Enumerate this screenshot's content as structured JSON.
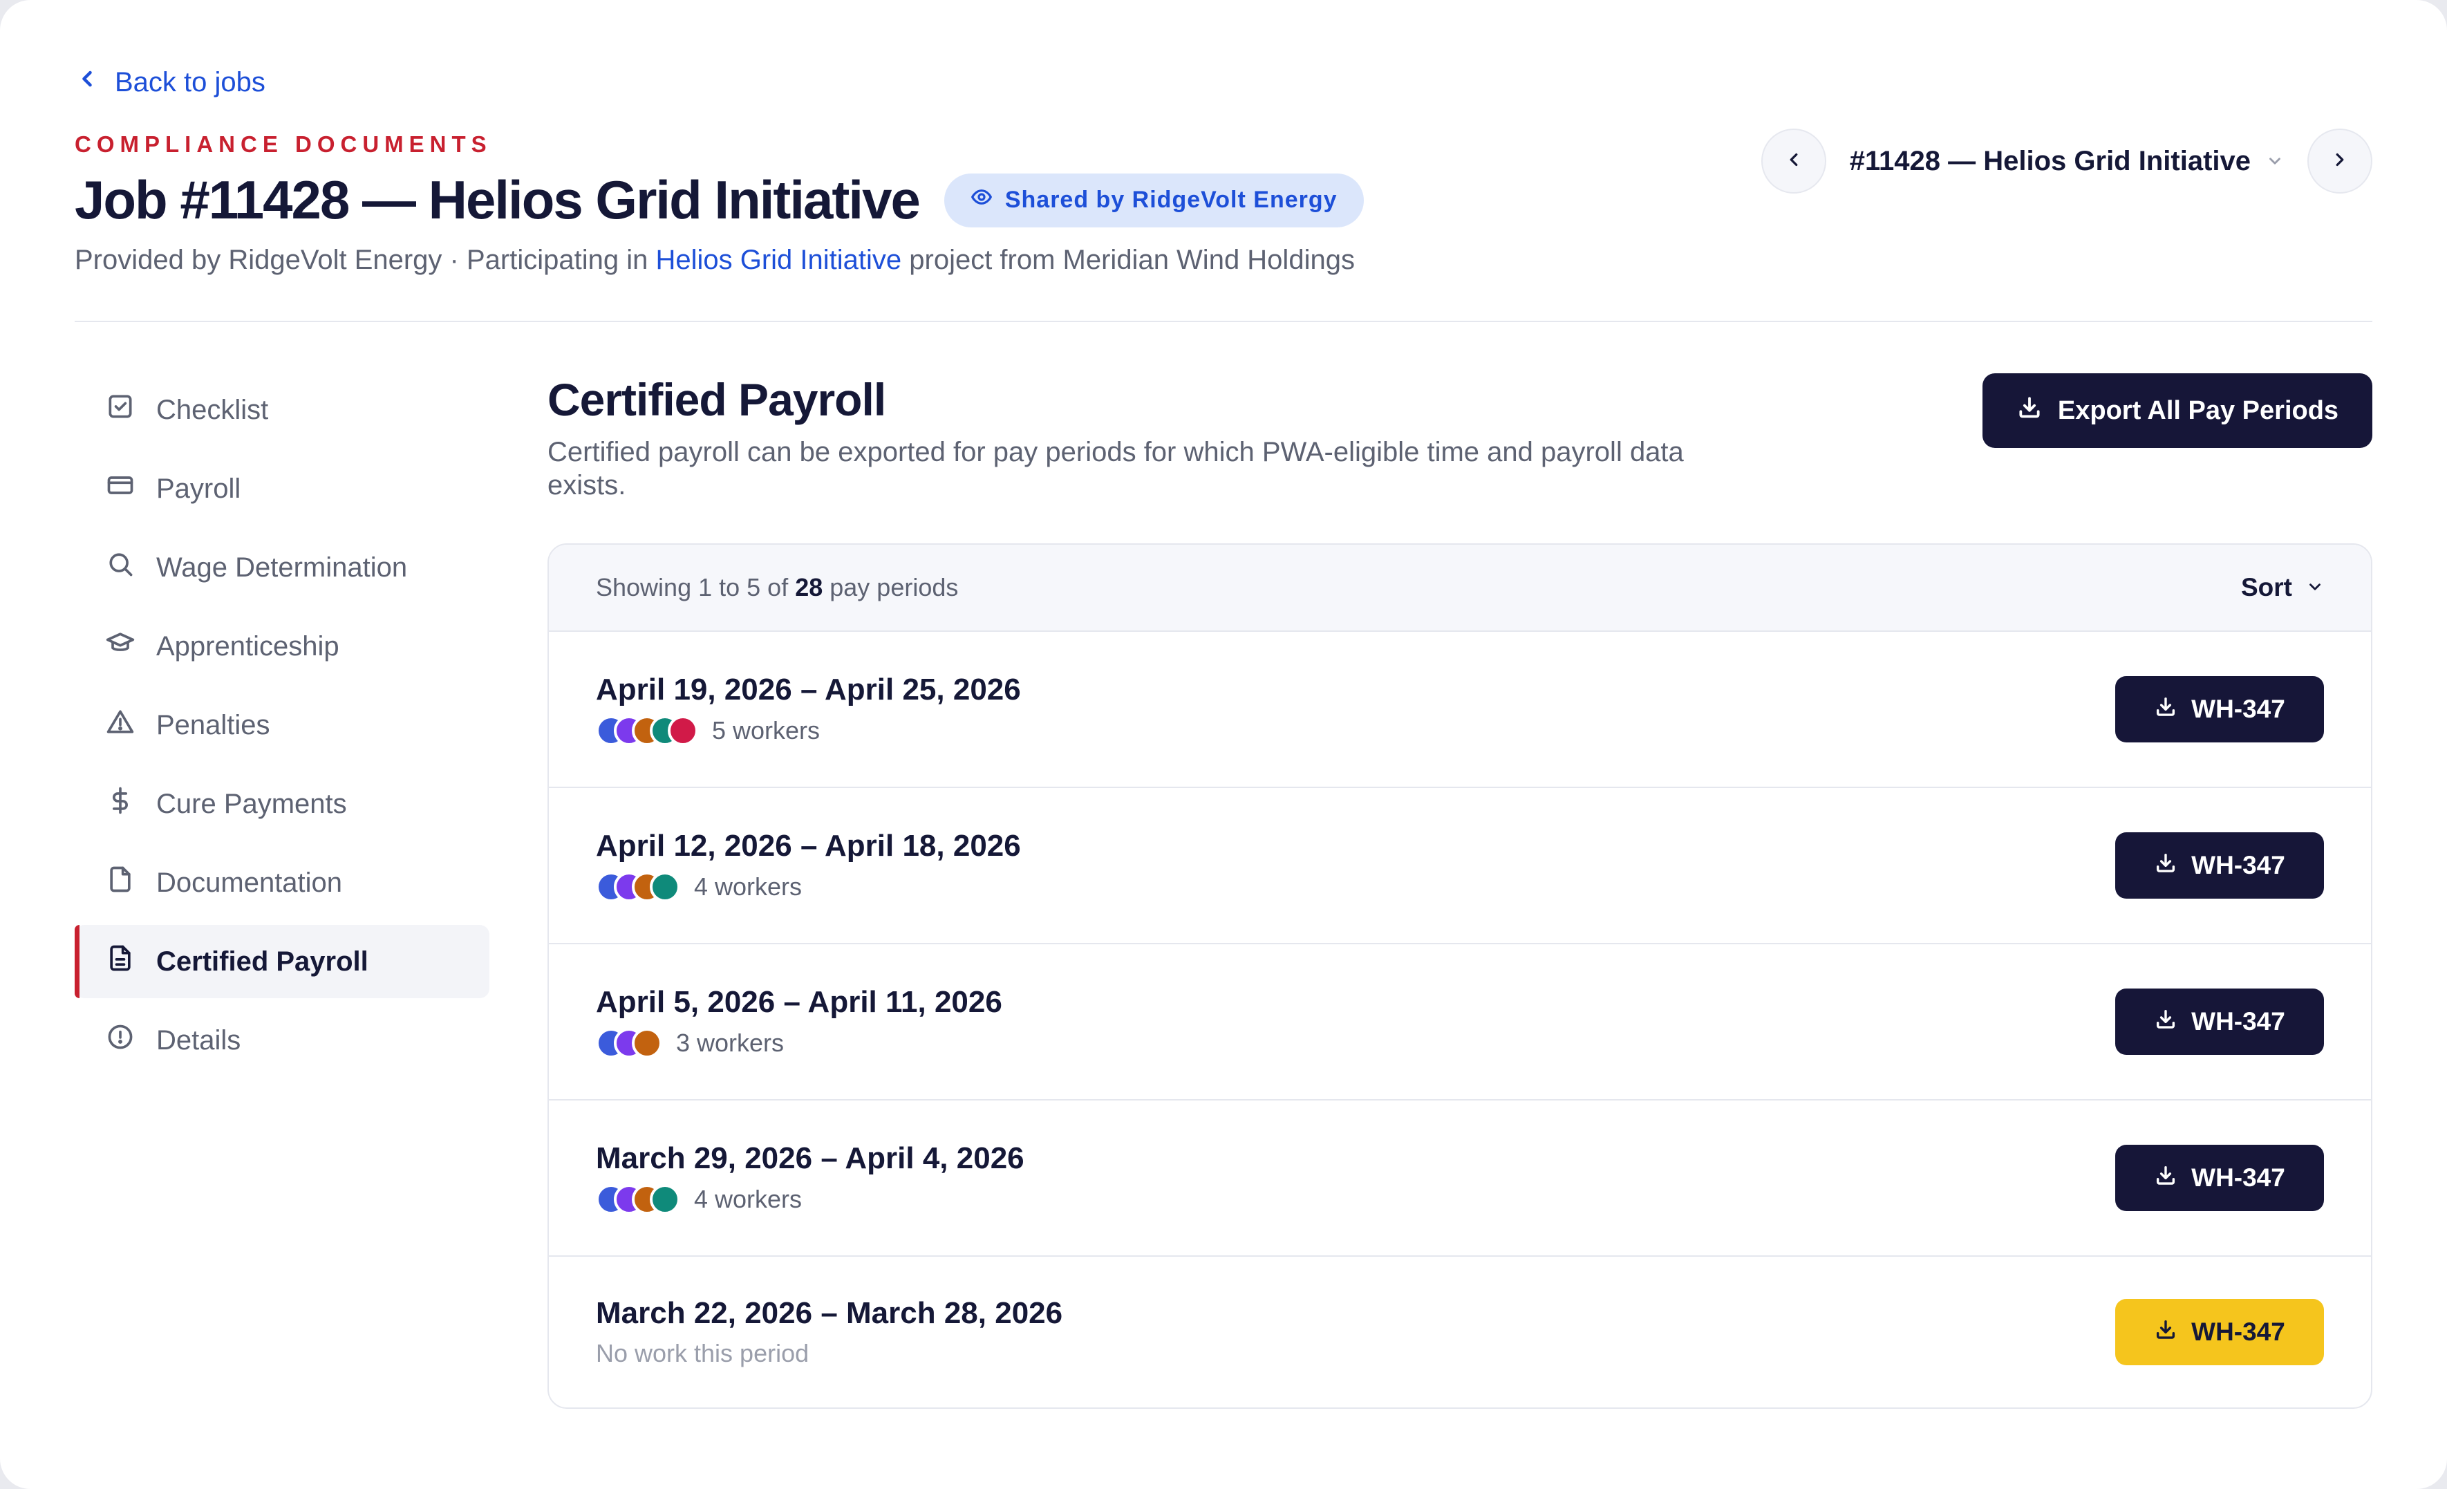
{
  "header": {
    "back_label": "Back to jobs",
    "eyebrow": "COMPLIANCE DOCUMENTS",
    "title": "Job #11428 — Helios Grid Initiative",
    "shared_badge": "Shared by RidgeVolt Energy",
    "subtitle_prefix": "Provided by RidgeVolt Energy · Participating in ",
    "subtitle_link": "Helios Grid Initiative",
    "subtitle_suffix": " project from Meridian Wind Holdings",
    "job_selector": "#11428 — Helios Grid Initiative"
  },
  "sidebar": {
    "items": [
      {
        "label": "Checklist",
        "icon": "checklist-icon",
        "active": false
      },
      {
        "label": "Payroll",
        "icon": "card-icon",
        "active": false
      },
      {
        "label": "Wage Determination",
        "icon": "search-icon",
        "active": false
      },
      {
        "label": "Apprenticeship",
        "icon": "graduation-cap-icon",
        "active": false
      },
      {
        "label": "Penalties",
        "icon": "warning-icon",
        "active": false
      },
      {
        "label": "Cure Payments",
        "icon": "dollar-icon",
        "active": false
      },
      {
        "label": "Documentation",
        "icon": "file-icon",
        "active": false
      },
      {
        "label": "Certified Payroll",
        "icon": "document-text-icon",
        "active": true
      },
      {
        "label": "Details",
        "icon": "info-circle-icon",
        "active": false
      }
    ]
  },
  "main": {
    "title": "Certified Payroll",
    "description": "Certified payroll can be exported for pay periods for which PWA-eligible time and payroll data exists.",
    "export_button": "Export All Pay Periods",
    "table": {
      "showing_prefix": "Showing 1 to 5 of ",
      "total": "28",
      "showing_suffix": " pay periods",
      "sort_label": "Sort",
      "rows": [
        {
          "range": "April 19, 2026 – April 25, 2026",
          "workers": "5 workers",
          "avatar_count": 5,
          "button": "WH-347",
          "highlight": false
        },
        {
          "range": "April 12, 2026 – April 18, 2026",
          "workers": "4 workers",
          "avatar_count": 4,
          "button": "WH-347",
          "highlight": false
        },
        {
          "range": "April 5, 2026 – April 11, 2026",
          "workers": "3 workers",
          "avatar_count": 3,
          "button": "WH-347",
          "highlight": false
        },
        {
          "range": "March 29, 2026 – April 4, 2026",
          "workers": "4 workers",
          "avatar_count": 4,
          "button": "WH-347",
          "highlight": false
        },
        {
          "range": "March 22, 2026 – March 28, 2026",
          "workers": "No work this period",
          "avatar_count": 0,
          "button": "WH-347",
          "highlight": true
        }
      ]
    }
  },
  "colors": {
    "accent_red": "#c8202f",
    "link_blue": "#1d4fd8",
    "primary_navy": "#161638",
    "highlight_yellow": "#f5c51d",
    "avatars": [
      "#3b5bdb",
      "#7c3aed",
      "#c2620f",
      "#0f8a7a",
      "#d11a48"
    ]
  }
}
